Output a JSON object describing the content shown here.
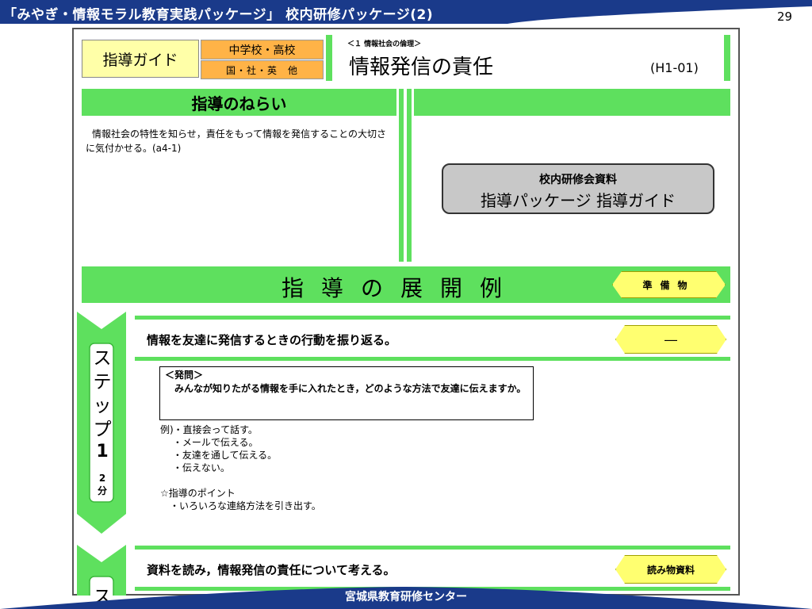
{
  "header": {
    "title": "「みやぎ・情報モラル教育実践パッケージ」 校内研修パッケージ(2)",
    "page_number": "29",
    "band_color": "#1a3a8a"
  },
  "guide": {
    "label": "指導ガイド",
    "school_level": "中学校・高校",
    "subjects": "国・社・英　他",
    "unit": "＜１ 情報社会の倫理＞",
    "lesson_title": "情報発信の責任",
    "lesson_code": "(H1-01)"
  },
  "aims": {
    "heading": "指導のねらい",
    "text": "情報社会の特性を知らせ，責任をもって情報を発信することの大切さに気付かせる。(a4-1)"
  },
  "badge": {
    "line1": "校内研修会資料",
    "line2": "指導パッケージ  指導ガイド"
  },
  "development": {
    "title": "指導の展開例",
    "materials_label": "準備物"
  },
  "step1": {
    "step_word": "ステップ",
    "number": "1",
    "minutes": "2\n分",
    "title": "情報を友達に発信するときの行動を振り返る。",
    "material": "―",
    "question_heading": "＜発問＞",
    "question_body": "みんなが知りたがる情報を手に入れたとき，どのような方法で友達に伝えますか。",
    "examples": "例)・直接会って話す。\n　 ・メールで伝える。\n　 ・友達を通して伝える。\n　 ・伝えない。",
    "point": "☆指導のポイント\n　・いろいろな連絡方法を引き出す。"
  },
  "step2": {
    "step_word": "ス",
    "title": "資料を読み，情報発信の責任について考える。",
    "material": "読み物資料"
  },
  "footer": {
    "text": "宮城県教育研修センター"
  },
  "colors": {
    "green": "#5ee05e",
    "yellow": "#ffff70",
    "orange": "#ffb347",
    "navy": "#1a3a8a"
  }
}
